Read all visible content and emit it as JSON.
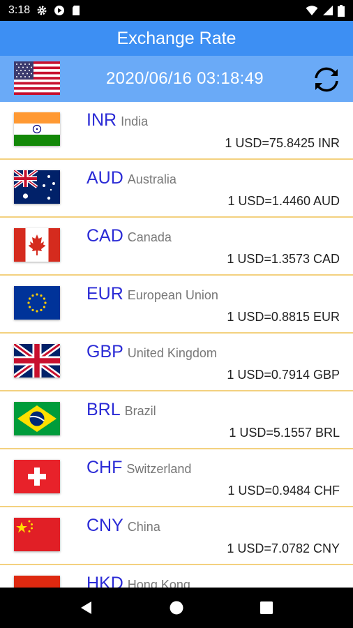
{
  "status_bar": {
    "time": "3:18"
  },
  "app_bar": {
    "title": "Exchange Rate"
  },
  "sub_bar": {
    "base_flag": "us-flag",
    "timestamp": "2020/06/16 03:18:49",
    "refresh_icon": "refresh-icon"
  },
  "rows": [
    {
      "code": "INR",
      "country": "India",
      "rate": "1 USD=75.8425 INR",
      "flag": "india-flag"
    },
    {
      "code": "AUD",
      "country": "Australia",
      "rate": "1 USD=1.4460 AUD",
      "flag": "australia-flag"
    },
    {
      "code": "CAD",
      "country": "Canada",
      "rate": "1 USD=1.3573 CAD",
      "flag": "canada-flag"
    },
    {
      "code": "EUR",
      "country": "European Union",
      "rate": "1 USD=0.8815 EUR",
      "flag": "eu-flag"
    },
    {
      "code": "GBP",
      "country": "United Kingdom",
      "rate": "1 USD=0.7914 GBP",
      "flag": "uk-flag"
    },
    {
      "code": "BRL",
      "country": "Brazil",
      "rate": "1 USD=5.1557 BRL",
      "flag": "brazil-flag"
    },
    {
      "code": "CHF",
      "country": "Switzerland",
      "rate": "1 USD=0.9484 CHF",
      "flag": "switzerland-flag"
    },
    {
      "code": "CNY",
      "country": "China",
      "rate": "1 USD=7.0782 CNY",
      "flag": "china-flag"
    },
    {
      "code": "HKD",
      "country": "Hong Kong",
      "rate": "",
      "flag": "hong-kong-flag"
    }
  ],
  "colors": {
    "app_bar": "#3d8ff3",
    "sub_bar": "#6aaaf7",
    "code_text": "#2b2bd6",
    "divider": "#f3d17f"
  }
}
